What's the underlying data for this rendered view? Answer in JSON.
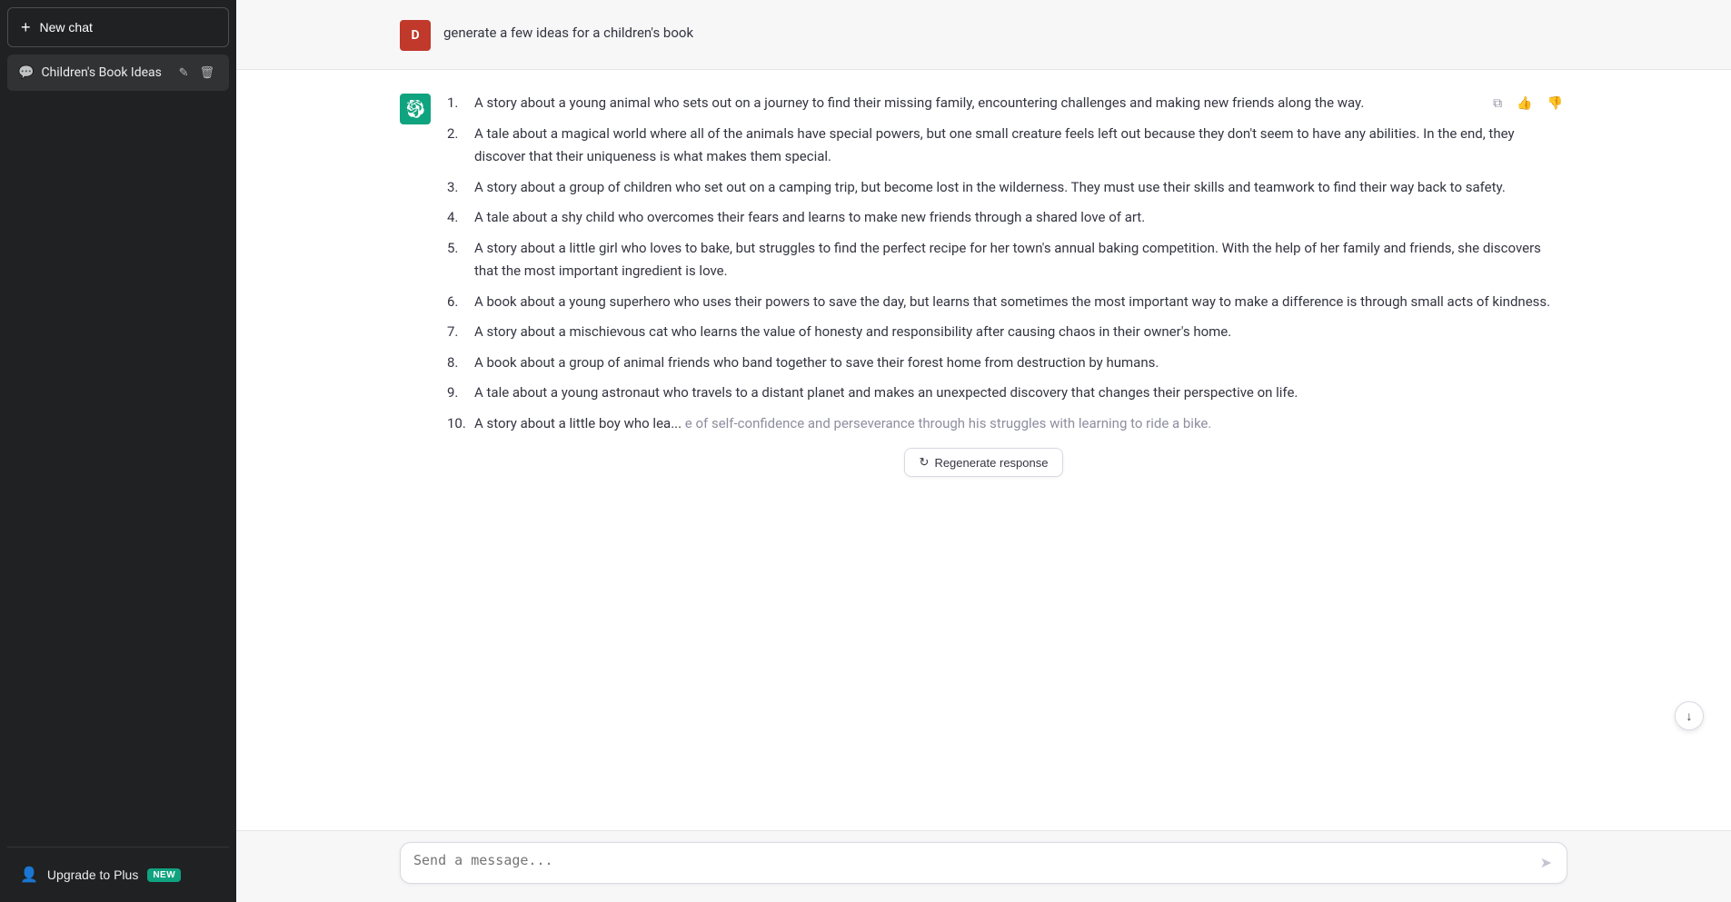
{
  "sidebar": {
    "new_chat_label": "New chat",
    "new_chat_plus": "+",
    "chat_history": [
      {
        "id": "1",
        "label": "Children's Book Ideas",
        "active": true
      }
    ],
    "upgrade_label": "Upgrade to Plus",
    "upgrade_badge": "NEW"
  },
  "header": {
    "user_initial": "D",
    "user_prompt": "generate a few ideas for a children's book"
  },
  "response": {
    "items": [
      {
        "num": "1.",
        "text": "A story about a young animal who sets out on a journey to find their missing family, encountering challenges and making new friends along the way."
      },
      {
        "num": "2.",
        "text": "A tale about a magical world where all of the animals have special powers, but one small creature feels left out because they don't seem to have any abilities. In the end, they discover that their uniqueness is what makes them special."
      },
      {
        "num": "3.",
        "text": "A story about a group of children who set out on a camping trip, but become lost in the wilderness. They must use their skills and teamwork to find their way back to safety."
      },
      {
        "num": "4.",
        "text": "A tale about a shy child who overcomes their fears and learns to make new friends through a shared love of art."
      },
      {
        "num": "5.",
        "text": "A story about a little girl who loves to bake, but struggles to find the perfect recipe for her town's annual baking competition. With the help of her family and friends, she discovers that the most important ingredient is love."
      },
      {
        "num": "6.",
        "text": "A book about a young superhero who uses their powers to save the day, but learns that sometimes the most important way to make a difference is through small acts of kindness."
      },
      {
        "num": "7.",
        "text": "A story about a mischievous cat who learns the value of honesty and responsibility after causing chaos in their owner's home."
      },
      {
        "num": "8.",
        "text": "A book about a group of animal friends who band together to save their forest home from destruction by humans."
      },
      {
        "num": "9.",
        "text": "A tale about a young astronaut who travels to a distant planet and makes an unexpected discovery that changes their perspective on life."
      },
      {
        "num": "10.",
        "text": "A story about a little boy who lea...",
        "partial": true,
        "partial_suffix": "e of self-confidence and perseverance through his struggles with learning to ride a bike."
      }
    ],
    "regenerate_label": "Regenerate response",
    "regenerate_icon": "↻"
  },
  "input": {
    "placeholder": "Send a message...",
    "send_icon": "▷"
  },
  "actions": {
    "copy_icon": "⧉",
    "thumbs_up_icon": "👍",
    "thumbs_down_icon": "👎",
    "scroll_down_icon": "↓"
  },
  "icons": {
    "chat_bubble": "💬",
    "pencil": "✎",
    "trash": "🗑",
    "person": "👤"
  }
}
